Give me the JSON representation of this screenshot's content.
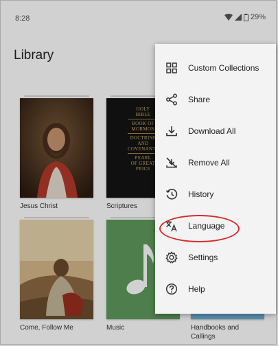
{
  "status_bar": {
    "time": "8:28",
    "battery": "29%"
  },
  "page_title": "Library",
  "items": [
    {
      "label": "Jesus Christ"
    },
    {
      "label": "Scriptures",
      "cover_lines": [
        "HOLY",
        "BIBLE",
        "BOOK OF",
        "MORMON",
        "DOCTRINE",
        "AND",
        "COVENANTS",
        "PEARL",
        "OF GREAT",
        "PRICE"
      ]
    },
    {
      "label": "Come, Follow Me"
    },
    {
      "label": "Music"
    },
    {
      "label": "Handbooks and Callings"
    }
  ],
  "menu": [
    {
      "label": "Custom Collections",
      "icon": "grid-icon"
    },
    {
      "label": "Share",
      "icon": "share-icon"
    },
    {
      "label": "Download All",
      "icon": "download-icon"
    },
    {
      "label": "Remove All",
      "icon": "remove-download-icon"
    },
    {
      "label": "History",
      "icon": "history-icon"
    },
    {
      "label": "Language",
      "icon": "translate-icon"
    },
    {
      "label": "Settings",
      "icon": "settings-icon"
    },
    {
      "label": "Help",
      "icon": "help-icon"
    }
  ],
  "colors": {
    "highlight": "#d92a2a",
    "music_green": "#5e9a5c",
    "menu_bg": "#f3f3f3"
  }
}
